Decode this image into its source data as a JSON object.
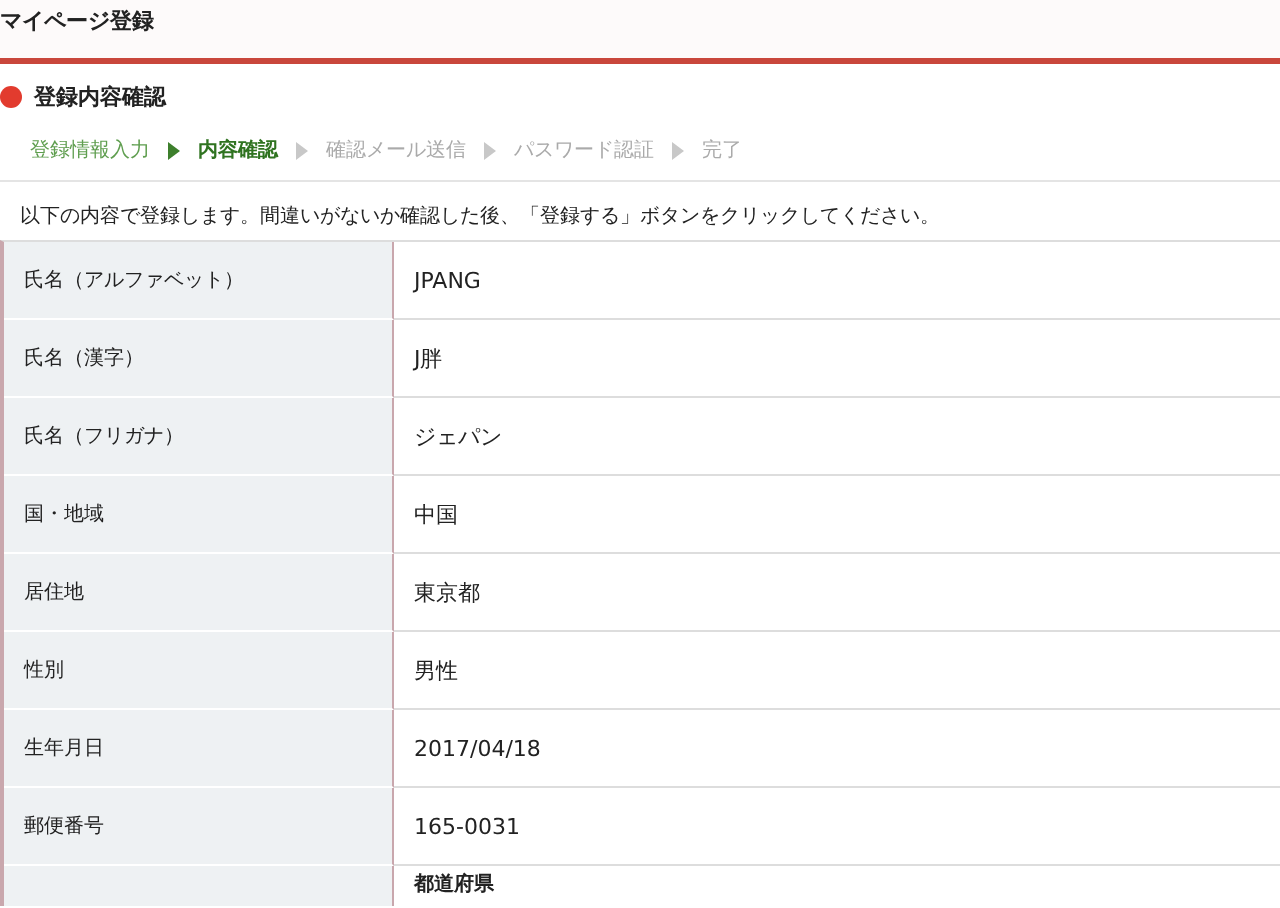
{
  "header": {
    "title": "マイページ登録"
  },
  "section": {
    "title": "登録内容確認"
  },
  "steps": [
    {
      "label": "登録情報入力",
      "completed": true,
      "selected": false
    },
    {
      "label": "内容確認",
      "completed": false,
      "selected": true
    },
    {
      "label": "確認メール送信",
      "completed": false,
      "selected": false
    },
    {
      "label": "パスワード認証",
      "completed": false,
      "selected": false
    },
    {
      "label": "完了",
      "completed": false,
      "selected": false
    }
  ],
  "instruction": "以下の内容で登録します。間違いがないか確認した後、「登録する」ボタンをクリックしてください。",
  "rows": [
    {
      "label": "氏名（アルファベット）",
      "value": "JPANG"
    },
    {
      "label": "氏名（漢字）",
      "value": "J胖"
    },
    {
      "label": "氏名（フリガナ）",
      "value": "ジェパン"
    },
    {
      "label": "国・地域",
      "value": "中国"
    },
    {
      "label": "居住地",
      "value": "東京都"
    },
    {
      "label": "性別",
      "value": "男性"
    },
    {
      "label": "生年月日",
      "value": "2017/04/18"
    },
    {
      "label": "郵便番号",
      "value": "165-0031"
    }
  ],
  "address_row": {
    "sublabel": "都道府県"
  }
}
